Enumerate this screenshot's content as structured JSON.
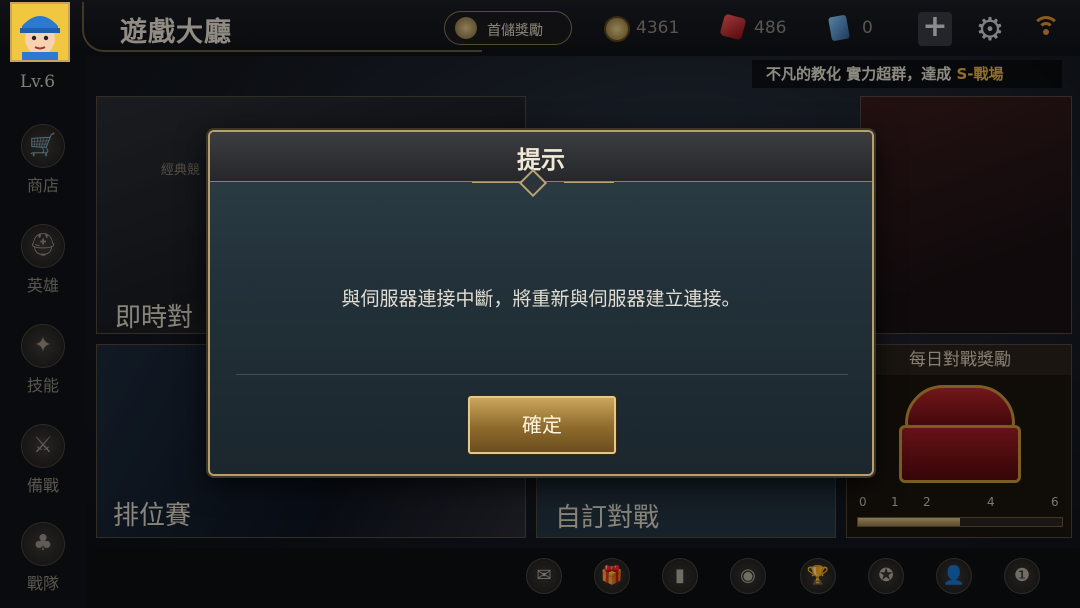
{
  "header": {
    "title": "遊戲大廳",
    "first_recharge_label": "首儲獎勵",
    "currencies": [
      {
        "icon": "gold-coin-icon",
        "value": "4361"
      },
      {
        "icon": "ruby-gem-icon",
        "value": "486"
      },
      {
        "icon": "card-icon",
        "value": "0"
      }
    ]
  },
  "player": {
    "level": "Lv.6"
  },
  "sidebar": {
    "items": [
      {
        "label": "商店",
        "icon": "shop-cart-icon"
      },
      {
        "label": "英雄",
        "icon": "helmet-icon"
      },
      {
        "label": "技能",
        "icon": "flame-icon"
      },
      {
        "label": "備戰",
        "icon": "sword-shield-icon"
      },
      {
        "label": "戰隊",
        "icon": "tree-emblem-icon"
      }
    ]
  },
  "marquee": {
    "text": "不凡的教化 實力超群，達成 ",
    "highlight": "S-戰場"
  },
  "modes": {
    "instant": {
      "label": "即時對",
      "sublabel": "經典競"
    },
    "ranked": {
      "label": "排位賽"
    },
    "custom": {
      "label": "自訂對戰"
    }
  },
  "daily_reward": {
    "title": "每日對戰獎勵",
    "ticks": [
      "0",
      "1",
      "2",
      "4",
      "6"
    ],
    "progress": 0.5
  },
  "bottom_bar": {
    "icons": [
      "chat-icon",
      "gift-icon",
      "bookmark-icon",
      "bag-icon",
      "trophy-icon",
      "badge-icon",
      "friends-icon",
      "rank-icon"
    ]
  },
  "dialog": {
    "title": "提示",
    "message": "與伺服器連接中斷，將重新與伺服器建立連接。",
    "confirm_label": "確定"
  },
  "colors": {
    "accent_gold": "#c9a55c",
    "highlight": "#e8b44a",
    "wifi": "#e59232"
  }
}
